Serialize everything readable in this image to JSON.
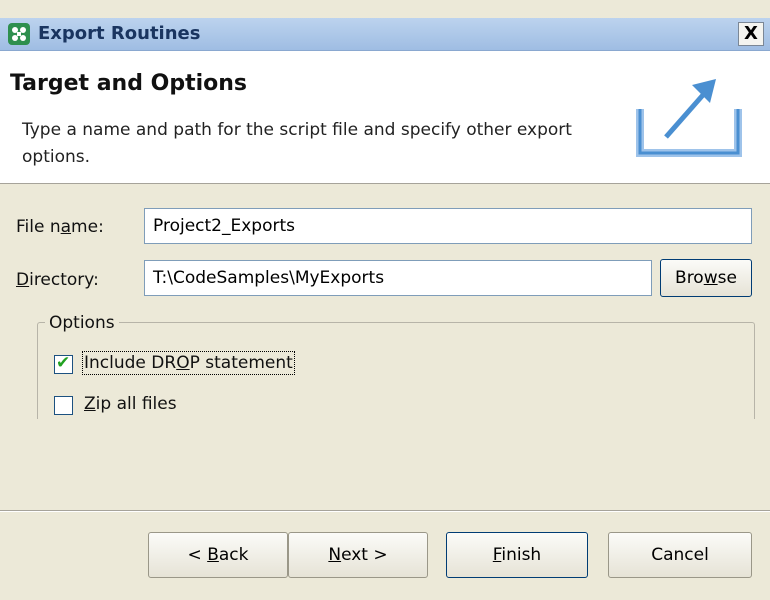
{
  "window": {
    "title": "Export Routines",
    "close_label": "X"
  },
  "banner": {
    "title": "Target and Options",
    "description": "Type a name and path for the script file and specify other export options."
  },
  "form": {
    "file_name": {
      "label_pre": "File n",
      "label_mn": "a",
      "label_post": "me:",
      "value": "Project2_Exports"
    },
    "directory": {
      "label_pre": "",
      "label_mn": "D",
      "label_post": "irectory:",
      "value": "T:\\CodeSamples\\MyExports"
    },
    "browse": {
      "pre": "Bro",
      "mn": "w",
      "post": "se"
    }
  },
  "options": {
    "legend": "Options",
    "include_drop": {
      "checked": true,
      "pre": "Include DR",
      "mn": "O",
      "post": "P statement"
    },
    "zip_all": {
      "checked": false,
      "pre": "",
      "mn": "Z",
      "post": "ip all files"
    }
  },
  "buttons": {
    "back": {
      "pre": "< ",
      "mn": "B",
      "post": "ack"
    },
    "next": {
      "pre": "",
      "mn": "N",
      "post": "ext >"
    },
    "finish": {
      "pre": "",
      "mn": "F",
      "post": "inish"
    },
    "cancel": {
      "label": "Cancel"
    }
  },
  "icons": {
    "app": "app-logo-icon",
    "export": "export-arrow-icon",
    "check": "checkmark-icon"
  },
  "colors": {
    "title_bar": "#bcd3ee",
    "dialog_bg": "#ece9d8",
    "check": "#21a121",
    "icon_blue": "#4a8fd1"
  }
}
